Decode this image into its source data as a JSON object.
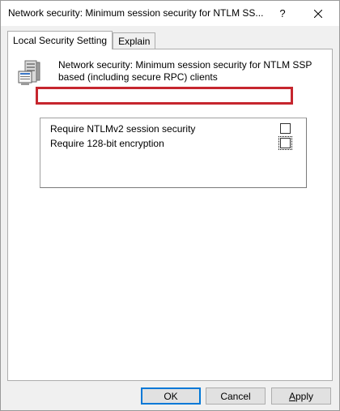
{
  "window": {
    "title": "Network security: Minimum session security for NTLM SS...",
    "help_glyph": "?",
    "close_icon": "close-icon"
  },
  "tabs": [
    {
      "label": "Local Security Setting",
      "active": true
    },
    {
      "label": "Explain",
      "active": false
    }
  ],
  "policy": {
    "icon": "server-policy-icon",
    "description": "Network security: Minimum session security for NTLM SSP based (including secure RPC) clients"
  },
  "options": [
    {
      "label": "Require NTLMv2 session security",
      "checked": false
    },
    {
      "label": "Require 128-bit encryption",
      "checked": false,
      "focused": true,
      "highlighted": true
    }
  ],
  "buttons": {
    "ok": "OK",
    "cancel": "Cancel",
    "apply_accel": "A",
    "apply_rest": "pply"
  },
  "colors": {
    "highlight_border": "#c6262e",
    "default_button_border": "#0078d7"
  }
}
